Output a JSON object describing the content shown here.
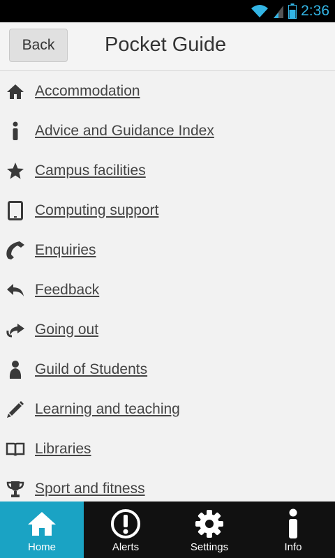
{
  "status_bar": {
    "time": "2:36"
  },
  "header": {
    "back_label": "Back",
    "title": "Pocket Guide"
  },
  "menu": {
    "items": [
      {
        "label": "Accommodation",
        "icon": "home-icon"
      },
      {
        "label": "Advice and Guidance Index",
        "icon": "info-icon"
      },
      {
        "label": "Campus facilities",
        "icon": "star-icon"
      },
      {
        "label": "Computing support",
        "icon": "tablet-icon"
      },
      {
        "label": "Enquiries",
        "icon": "phone-icon"
      },
      {
        "label": "Feedback",
        "icon": "reply-icon"
      },
      {
        "label": "Going out",
        "icon": "share-icon"
      },
      {
        "label": "Guild of Students",
        "icon": "user-icon"
      },
      {
        "label": "Learning and teaching",
        "icon": "pencil-icon"
      },
      {
        "label": "Libraries",
        "icon": "book-icon"
      },
      {
        "label": "Sport and fitness",
        "icon": "trophy-icon"
      }
    ]
  },
  "tabbar": {
    "accent": "#1aa3c4",
    "tabs": [
      {
        "label": "Home",
        "icon": "home-icon",
        "active": true
      },
      {
        "label": "Alerts",
        "icon": "alert-icon",
        "active": false
      },
      {
        "label": "Settings",
        "icon": "gear-icon",
        "active": false
      },
      {
        "label": "Info",
        "icon": "info-icon",
        "active": false
      }
    ]
  }
}
